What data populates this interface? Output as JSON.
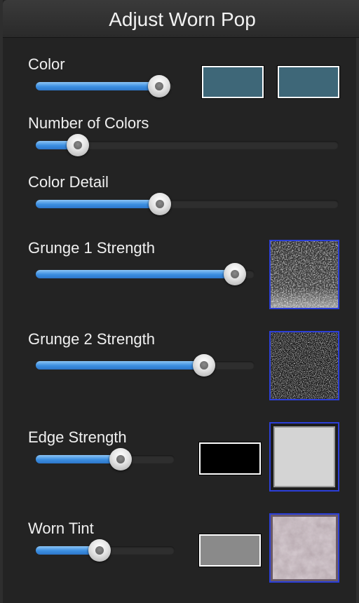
{
  "window": {
    "title": "Adjust Worn Pop"
  },
  "controls": {
    "color": {
      "label": "Color",
      "value": 0.9,
      "swatch1": "#3e6778",
      "swatch2": "#3e6778"
    },
    "num_colors": {
      "label": "Number of Colors",
      "value": 0.14
    },
    "color_detail": {
      "label": "Color Detail",
      "value": 0.41
    },
    "grunge1": {
      "label": "Grunge 1 Strength",
      "value": 0.91,
      "texture": "grunge-texture-1"
    },
    "grunge2": {
      "label": "Grunge 2 Strength",
      "value": 0.77,
      "texture": "grunge-texture-2"
    },
    "edge": {
      "label": "Edge Strength",
      "value": 0.61,
      "swatch": "#000000",
      "texture": "edge-texture"
    },
    "tint": {
      "label": "Worn Tint",
      "value": 0.46,
      "swatch": "#8a8a8a",
      "texture": "worn-tint-texture"
    }
  },
  "colors": {
    "accent": "#3b8ee0",
    "thumb_border": "#2c3fd8",
    "panel_bg": "#232323"
  }
}
